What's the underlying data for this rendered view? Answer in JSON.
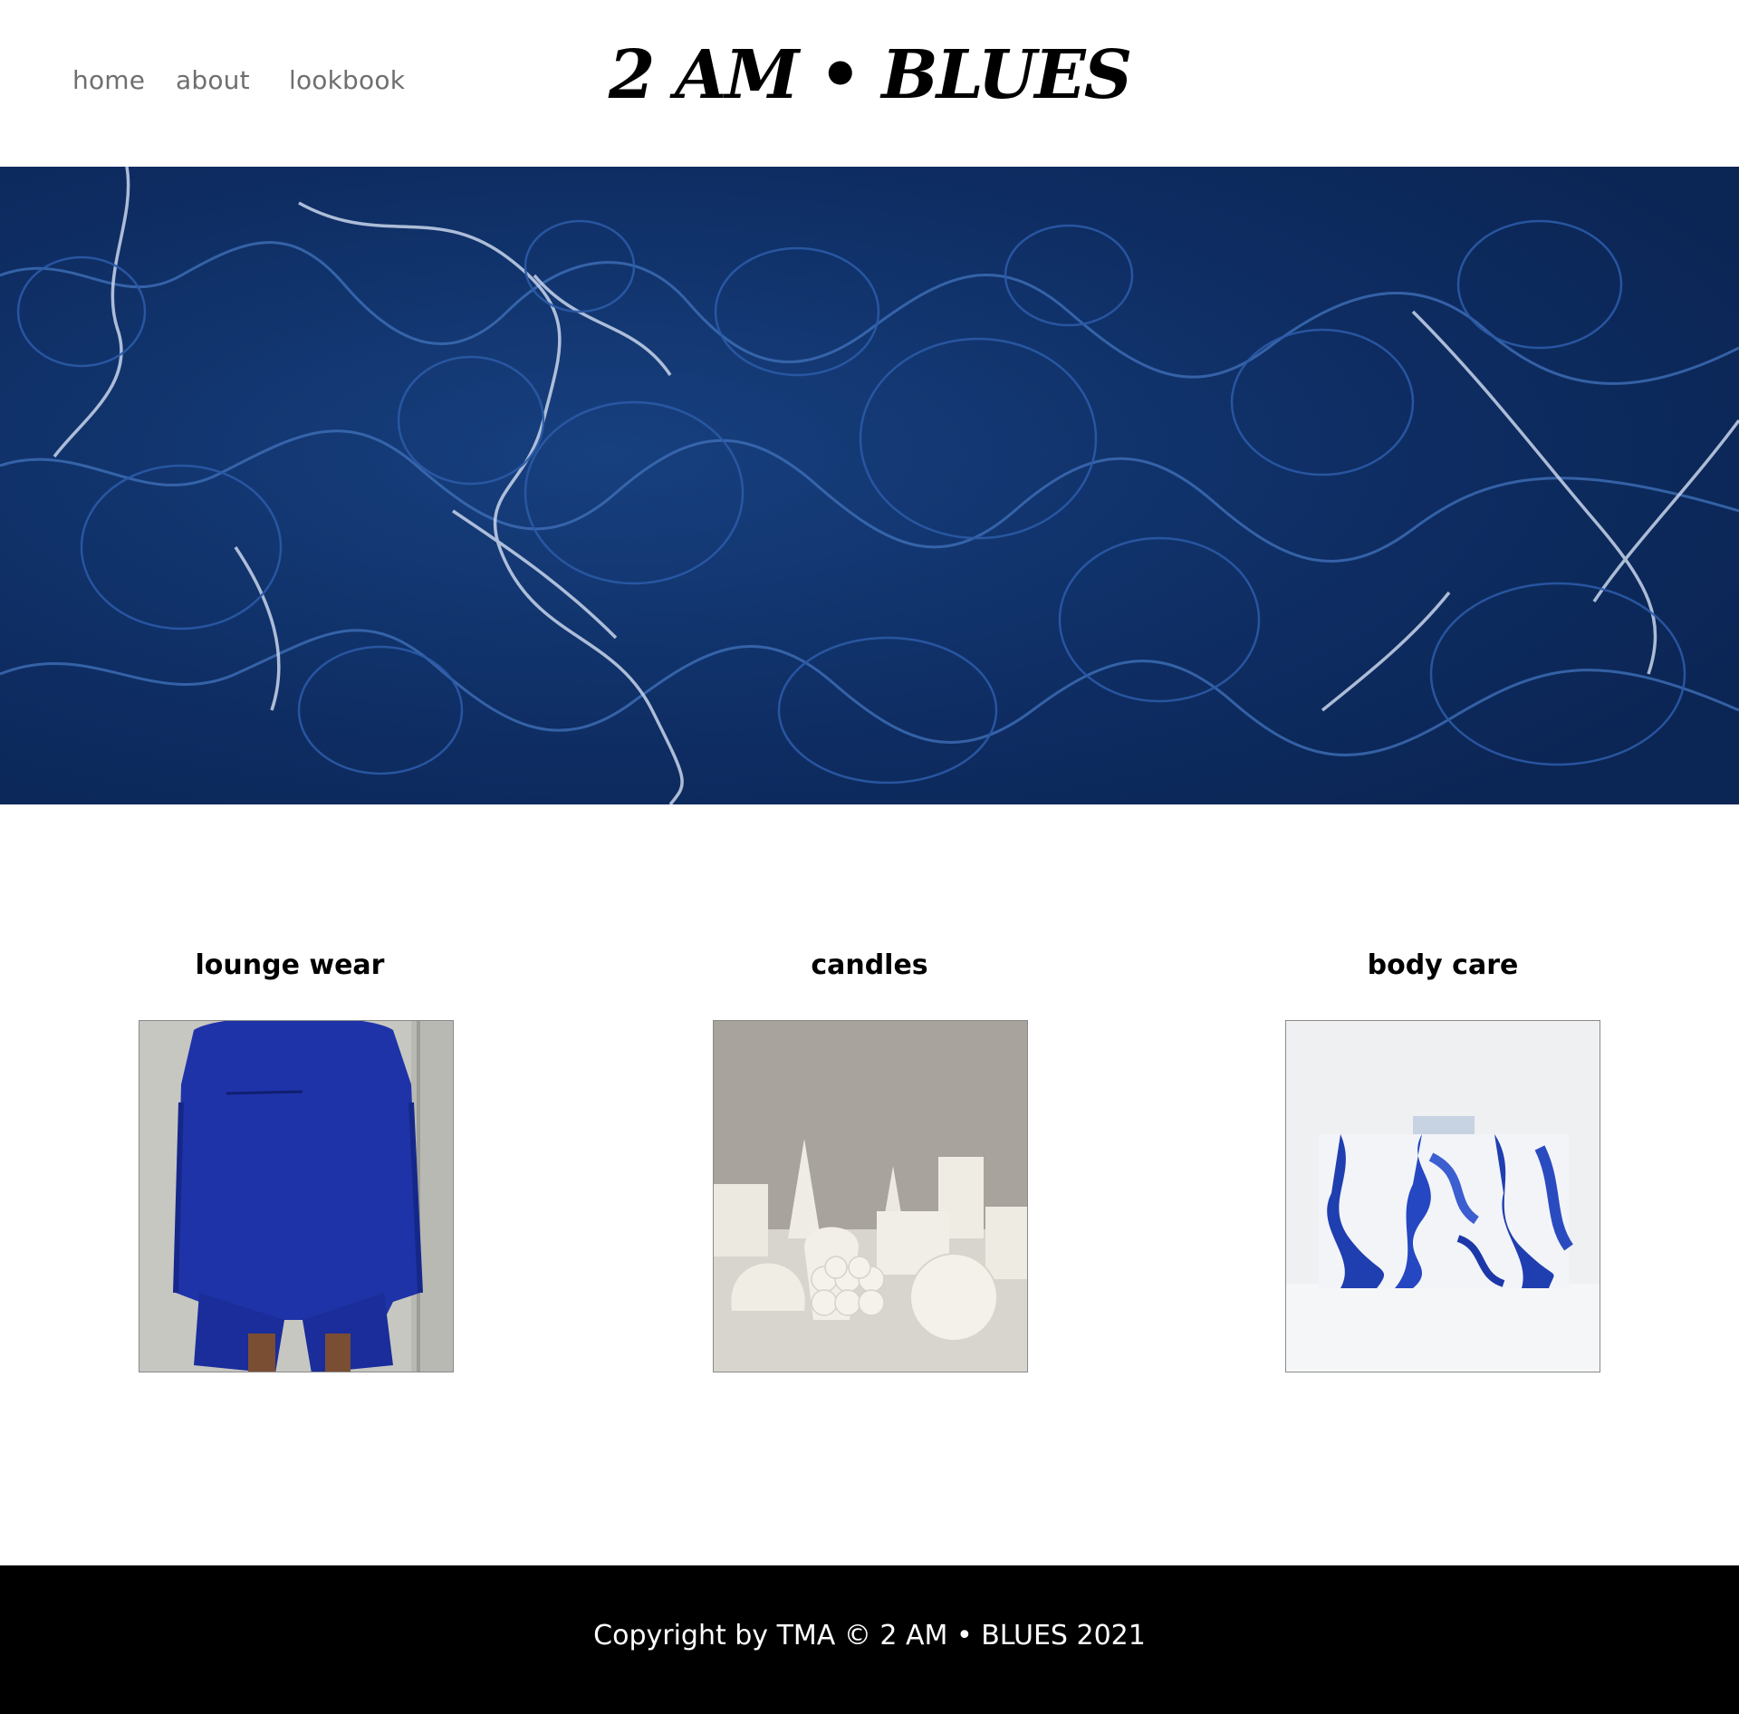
{
  "site": {
    "logo": "2 AM • BLUES"
  },
  "nav": {
    "items": [
      {
        "label": "home"
      },
      {
        "label": "about"
      },
      {
        "label": "lookbook"
      }
    ]
  },
  "hero": {
    "image": "blue-marble-texture"
  },
  "categories": [
    {
      "title": "lounge wear",
      "image": "blue-sweatsuit-photo"
    },
    {
      "title": "candles",
      "image": "white-candles-photo"
    },
    {
      "title": "body care",
      "image": "blue-marble-soap-photo"
    }
  ],
  "footer": {
    "copyright": "Copyright by TMA © 2 AM • BLUES 2021"
  },
  "colors": {
    "hero_blue": "#0d2a5c",
    "nav_text": "#6f6f6f",
    "footer_bg": "#000000"
  }
}
